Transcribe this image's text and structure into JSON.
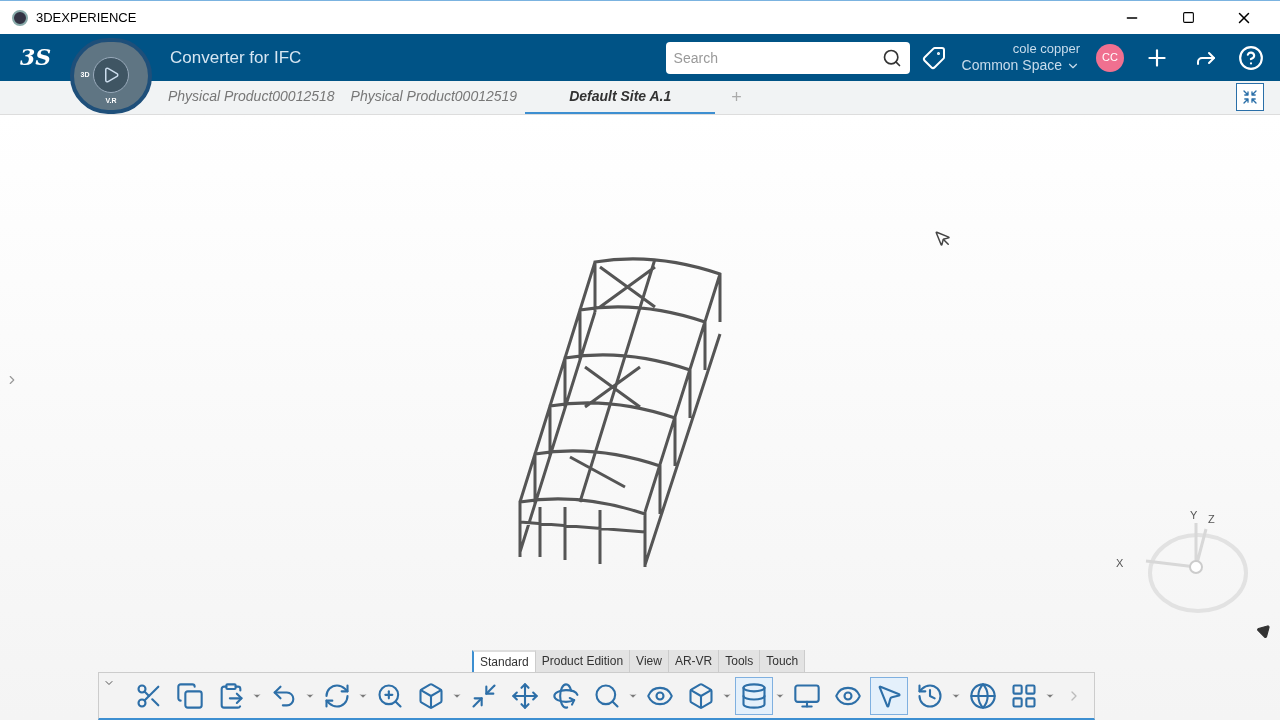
{
  "window": {
    "title": "3DEXPERIENCE"
  },
  "brand": {
    "logo": "3S"
  },
  "compass": {
    "labels": [
      "3D",
      "V.R"
    ]
  },
  "app": {
    "title": "Converter for IFC"
  },
  "search": {
    "placeholder": "Search"
  },
  "user": {
    "name": "cole copper",
    "space": "Common Space",
    "initials": "CC"
  },
  "doc_tabs": [
    {
      "label": "Physical Product00012518",
      "selected": false
    },
    {
      "label": "Physical Product00012519",
      "selected": false
    },
    {
      "label": "Default Site A.1",
      "selected": true
    }
  ],
  "add_tab": "+",
  "compass_axes": [
    "X",
    "Y",
    "Z"
  ],
  "section_tabs": [
    {
      "label": "Standard",
      "selected": true
    },
    {
      "label": "Product Edition",
      "selected": false
    },
    {
      "label": "View",
      "selected": false
    },
    {
      "label": "AR-VR",
      "selected": false
    },
    {
      "label": "Tools",
      "selected": false
    },
    {
      "label": "Touch",
      "selected": false
    }
  ],
  "tools": [
    {
      "kind": "cut",
      "dropdown": false,
      "selected": false
    },
    {
      "kind": "copy",
      "dropdown": false,
      "selected": false
    },
    {
      "kind": "paste",
      "dropdown": true,
      "selected": false
    },
    {
      "kind": "undo",
      "dropdown": true,
      "selected": false
    },
    {
      "kind": "refresh",
      "dropdown": true,
      "selected": false
    },
    {
      "kind": "zoom-area",
      "dropdown": false,
      "selected": false
    },
    {
      "kind": "cube",
      "dropdown": true,
      "selected": false
    },
    {
      "kind": "fit",
      "dropdown": false,
      "selected": false
    },
    {
      "kind": "pan",
      "dropdown": false,
      "selected": false
    },
    {
      "kind": "rotate",
      "dropdown": false,
      "selected": false
    },
    {
      "kind": "zoom",
      "dropdown": true,
      "selected": false
    },
    {
      "kind": "look",
      "dropdown": false,
      "selected": false
    },
    {
      "kind": "cube",
      "dropdown": true,
      "selected": false
    },
    {
      "kind": "database",
      "dropdown": true,
      "selected": true
    },
    {
      "kind": "monitor",
      "dropdown": false,
      "selected": false
    },
    {
      "kind": "eye",
      "dropdown": false,
      "selected": false
    },
    {
      "kind": "pointer",
      "dropdown": false,
      "selected": true
    },
    {
      "kind": "history",
      "dropdown": true,
      "selected": false
    },
    {
      "kind": "render",
      "dropdown": false,
      "selected": false
    },
    {
      "kind": "grid",
      "dropdown": true,
      "selected": false
    }
  ]
}
